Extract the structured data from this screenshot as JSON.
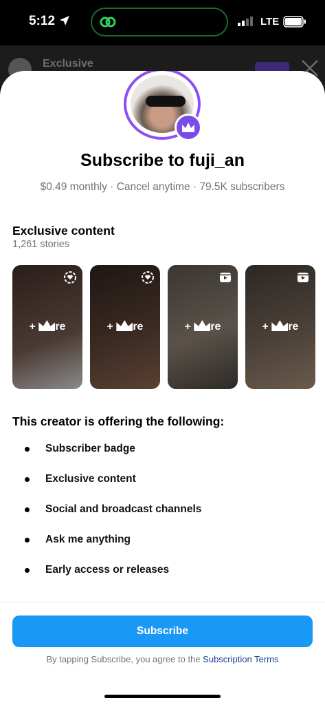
{
  "status_bar": {
    "time": "5:12",
    "network": "LTE"
  },
  "background": {
    "title": "Exclusive"
  },
  "sheet": {
    "title": "Subscribe to fuji_an",
    "subtitle": "$0.49 monthly · Cancel anytime · 79.5K subscribers",
    "exclusive": {
      "title": "Exclusive content",
      "count": "1,261 stories",
      "cards": [
        {
          "icon": "story-circle-icon",
          "label": "+",
          "suffix": "re"
        },
        {
          "icon": "story-circle-icon",
          "label": "+",
          "suffix": "re"
        },
        {
          "icon": "reel-icon",
          "label": "+",
          "suffix": "re"
        },
        {
          "icon": "reel-icon",
          "label": "+",
          "suffix": "re"
        }
      ]
    },
    "offers": {
      "title": "This creator is offering the following:",
      "items": [
        "Subscriber badge",
        "Exclusive content",
        "Social and broadcast channels",
        "Ask me anything",
        "Early access or releases"
      ]
    },
    "subscribe_label": "Subscribe",
    "terms_prefix": "By tapping Subscribe, you agree to the ",
    "terms_link": "Subscription Terms"
  },
  "colors": {
    "accent": "#1a98f5",
    "crown": "#7b4be8",
    "link": "#1c3f91"
  }
}
